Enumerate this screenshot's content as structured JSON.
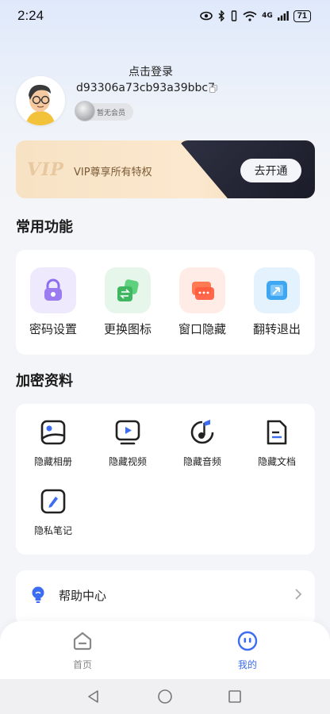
{
  "status_bar": {
    "time": "2:24",
    "network": "4G",
    "battery": "71"
  },
  "profile": {
    "login_prompt": "点击登录",
    "user_id": "d93306a73cb93a39bbc7",
    "member_status": "暂无会员"
  },
  "vip": {
    "logo": "VIP",
    "text": "VIP尊享所有特权",
    "button": "去开通"
  },
  "common_functions": {
    "title": "常用功能",
    "items": [
      {
        "label": "密码设置",
        "icon": "lock-icon",
        "color": "#9b7cf0"
      },
      {
        "label": "更换图标",
        "icon": "swap-icon",
        "color": "#4fc06d"
      },
      {
        "label": "窗口隐藏",
        "icon": "window-icon",
        "color": "#ff6b4a"
      },
      {
        "label": "翻转退出",
        "icon": "flip-icon",
        "color": "#3fa6f2"
      }
    ]
  },
  "encrypted_data": {
    "title": "加密资料",
    "items": [
      {
        "label": "隐藏相册",
        "icon": "photo-icon"
      },
      {
        "label": "隐藏视频",
        "icon": "video-icon"
      },
      {
        "label": "隐藏音频",
        "icon": "audio-icon"
      },
      {
        "label": "隐藏文档",
        "icon": "document-icon"
      },
      {
        "label": "隐私笔记",
        "icon": "note-icon"
      }
    ]
  },
  "help": {
    "label": "帮助中心"
  },
  "bottom_nav": {
    "items": [
      {
        "label": "首页",
        "icon": "home-icon",
        "active": false
      },
      {
        "label": "我的",
        "icon": "profile-face-icon",
        "active": true
      }
    ],
    "active_color": "#3b6cf2"
  }
}
